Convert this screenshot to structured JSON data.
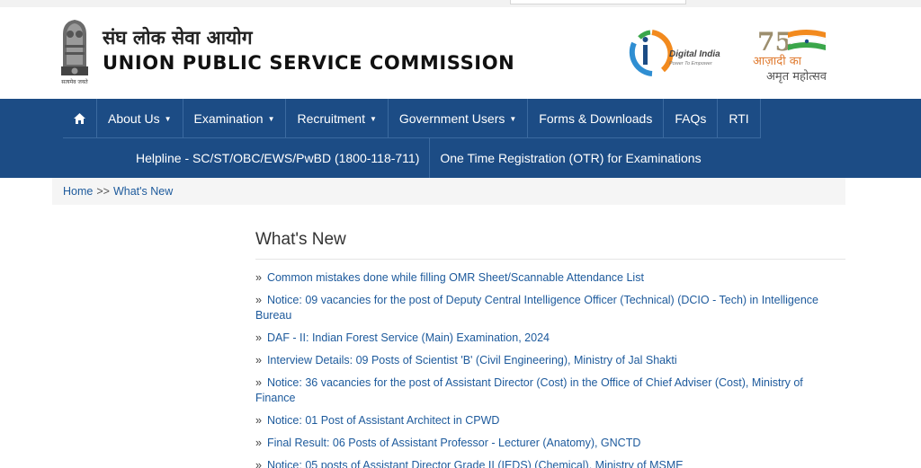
{
  "header": {
    "hindi_title": "संघ लोक सेवा आयोग",
    "english_title": "UNION PUBLIC SERVICE COMMISSION",
    "emblem_motto": "सत्यमेव जयते",
    "digital_india": "Digital India",
    "digital_india_tagline": "Power To Empower",
    "azadi_line1": "आज़ादी का",
    "azadi_line2": "अमृत महोत्सव",
    "azadi_number": "75"
  },
  "nav": {
    "row1": [
      {
        "label": "About Us",
        "dropdown": true
      },
      {
        "label": "Examination",
        "dropdown": true
      },
      {
        "label": "Recruitment",
        "dropdown": true
      },
      {
        "label": "Government Users",
        "dropdown": true
      },
      {
        "label": "Forms & Downloads",
        "dropdown": false
      },
      {
        "label": "FAQs",
        "dropdown": false
      },
      {
        "label": "RTI",
        "dropdown": false
      }
    ],
    "row2": [
      {
        "label": "Helpline - SC/ST/OBC/EWS/PwBD (1800-118-711)"
      },
      {
        "label": "One Time Registration (OTR) for Examinations"
      }
    ]
  },
  "breadcrumb": {
    "home": "Home",
    "separator": ">>",
    "current": "What's New"
  },
  "main": {
    "title": "What's New",
    "bullet": "»",
    "items": [
      "Common mistakes done while filling OMR Sheet/Scannable Attendance List",
      "Notice: 09 vacancies for the post of Deputy Central Intelligence Officer (Technical) (DCIO - Tech) in Intelligence Bureau",
      "DAF - II: Indian Forest Service (Main) Examination, 2024",
      "Interview Details: 09 Posts of Scientist 'B' (Civil Engineering), Ministry of Jal Shakti",
      "Notice: 36 vacancies for the post of Assistant Director (Cost) in the Office of Chief Adviser (Cost), Ministry of Finance",
      "Notice: 01 Post of Assistant Architect in CPWD",
      "Final Result: 06 Posts of Assistant Professor - Lecturer (Anatomy), GNCTD",
      "Notice: 05 posts of Assistant Director Grade II (IEDS) (Chemical), Ministry of MSME"
    ]
  },
  "colors": {
    "nav_bg": "#1c4c85",
    "link": "#1d5a9c"
  }
}
